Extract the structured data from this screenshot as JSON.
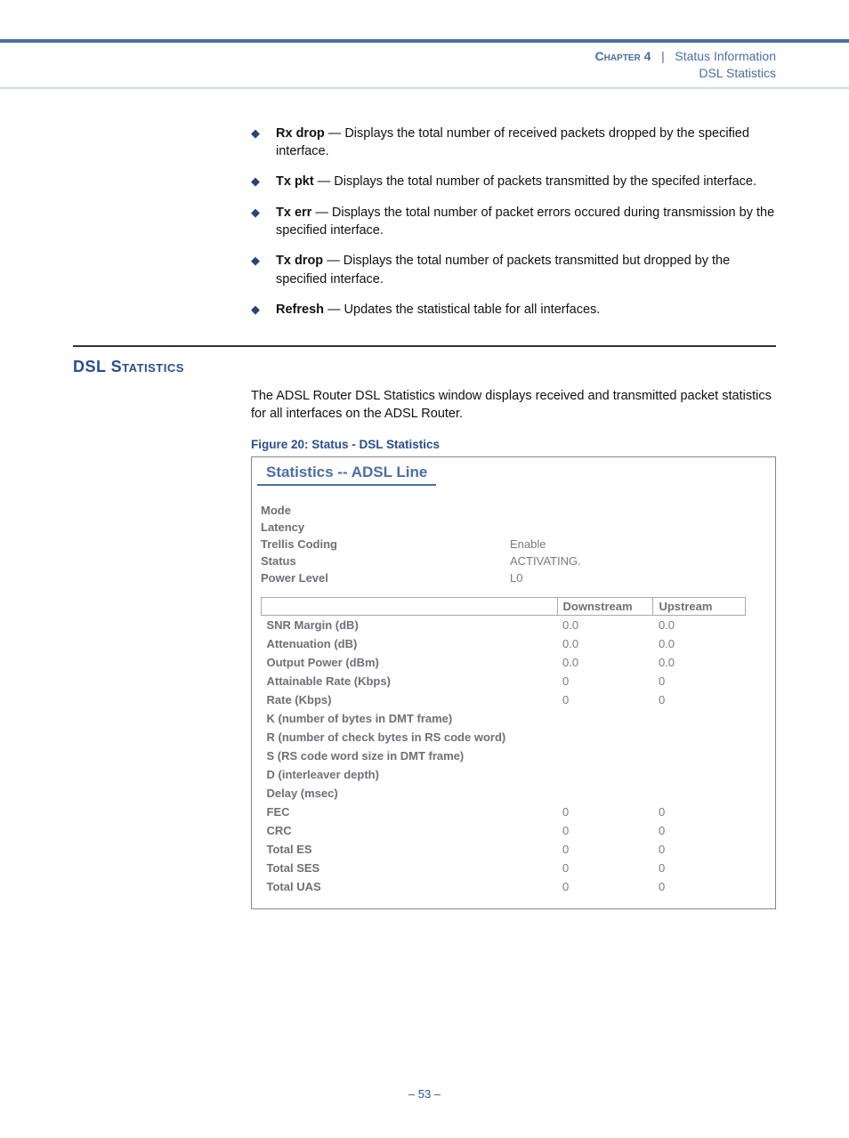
{
  "header": {
    "chapter": "Chapter 4",
    "separator": "|",
    "section": "Status Information",
    "subsection": "DSL Statistics"
  },
  "definitions": [
    {
      "term": "Rx drop",
      "text": " — Displays the total number of received packets dropped by the specified interface."
    },
    {
      "term": "Tx pkt",
      "text": " — Displays the total number of packets transmitted by the specifed interface."
    },
    {
      "term": "Tx err",
      "text": " — Displays the total number of packet errors occured during transmission by the specified interface."
    },
    {
      "term": "Tx drop",
      "text": " — Displays the total number of packets transmitted but dropped by the specified interface."
    },
    {
      "term": "Refresh",
      "text": " — Updates the statistical table for all interfaces."
    }
  ],
  "section_heading": "DSL Statistics",
  "intro": "The ADSL Router DSL Statistics window displays received and transmitted packet statistics for all interfaces on the ADSL Router.",
  "figure_caption": "Figure 20:  Status - DSL Statistics",
  "screenshot": {
    "title": "Statistics -- ADSL Line",
    "props": [
      {
        "label": "Mode",
        "value": ""
      },
      {
        "label": "Latency",
        "value": ""
      },
      {
        "label": "Trellis Coding",
        "value": "Enable"
      },
      {
        "label": "Status",
        "value": "ACTIVATING."
      },
      {
        "label": "Power Level",
        "value": "L0"
      }
    ],
    "table": {
      "columns": [
        "",
        "Downstream",
        "Upstream"
      ],
      "rows": [
        {
          "label": "SNR Margin (dB)",
          "down": "0.0",
          "up": "0.0"
        },
        {
          "label": "Attenuation (dB)",
          "down": "0.0",
          "up": "0.0"
        },
        {
          "label": "Output Power (dBm)",
          "down": "0.0",
          "up": "0.0"
        },
        {
          "label": "Attainable Rate (Kbps)",
          "down": "0",
          "up": "0"
        },
        {
          "label": "Rate (Kbps)",
          "down": "0",
          "up": "0"
        },
        {
          "label": "K (number of bytes in DMT frame)",
          "down": "",
          "up": ""
        },
        {
          "label": "R (number of check bytes in RS code word)",
          "down": "",
          "up": ""
        },
        {
          "label": "S (RS code word size in DMT frame)",
          "down": "",
          "up": ""
        },
        {
          "label": "D (interleaver depth)",
          "down": "",
          "up": ""
        },
        {
          "label": "Delay (msec)",
          "down": "",
          "up": ""
        },
        {
          "label": "FEC",
          "down": "0",
          "up": "0"
        },
        {
          "label": "CRC",
          "down": "0",
          "up": "0"
        },
        {
          "label": "Total ES",
          "down": "0",
          "up": "0"
        },
        {
          "label": "Total SES",
          "down": "0",
          "up": "0"
        },
        {
          "label": "Total UAS",
          "down": "0",
          "up": "0"
        }
      ]
    }
  },
  "page_number": "–  53  –"
}
